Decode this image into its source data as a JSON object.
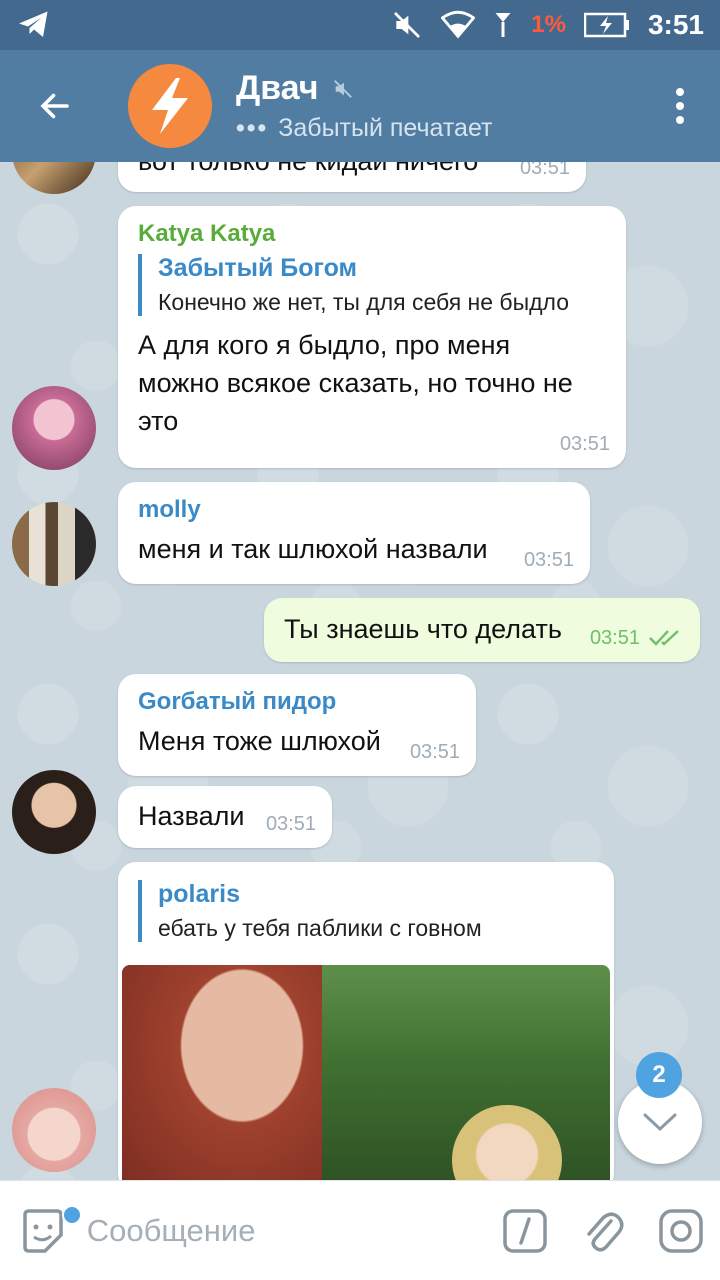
{
  "status_bar": {
    "battery_percent": "1%",
    "time": "3:51"
  },
  "header": {
    "title": "Двач",
    "typing_dots": "•••",
    "status": "Забытый печатает"
  },
  "messages": [
    {
      "id": "m0",
      "text": "вот только не кидай ничего",
      "time": "03:51"
    },
    {
      "id": "m1",
      "sender": "Katya Katya",
      "sender_color": "#5aac3a",
      "reply_name": "Забытый Богом",
      "reply_text": "Конечно же нет, ты для себя не быдло",
      "text": "А для кого я быдло, про меня можно всякое сказать, но точно не это",
      "time": "03:51"
    },
    {
      "id": "m2",
      "sender": "molly",
      "sender_color": "#3a8ac7",
      "text": "меня и так шлюхой назвали",
      "time": "03:51"
    },
    {
      "id": "m3",
      "outgoing": true,
      "text": "Ты знаешь что делать",
      "time": "03:51"
    },
    {
      "id": "m4",
      "sender": "Gorбатый пидор",
      "sender_color": "#3a8ac7",
      "text": "Меня тоже шлюхой",
      "time": "03:51"
    },
    {
      "id": "m5",
      "text": "Назвали",
      "time": "03:51"
    },
    {
      "id": "m6",
      "reply_name": "polaris",
      "reply_text": "ебать у тебя паблики с говном"
    }
  ],
  "scroll_fab": {
    "unread_count": "2"
  },
  "input": {
    "placeholder": "Сообщение"
  },
  "colors": {
    "header": "#517da2",
    "status_bar": "#43698f",
    "outgoing_bubble": "#effdde",
    "accent": "#4fa3e0"
  }
}
